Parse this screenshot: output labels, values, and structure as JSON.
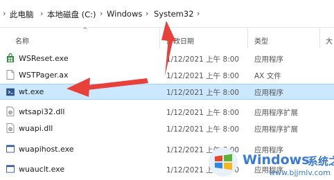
{
  "breadcrumb": {
    "items": [
      "此电脑",
      "本地磁盘 (C:)",
      "Windows",
      "System32"
    ]
  },
  "columns": {
    "name": "名称",
    "date": "修改日期",
    "type": "类型",
    "size": "大"
  },
  "files": [
    {
      "name": "WSReset.exe",
      "date": "1/12/2021 上午 8:00",
      "type": "应用程序",
      "icon": "wsreset-icon",
      "selected": false
    },
    {
      "name": "WSTPager.ax",
      "date": "1/12/2021 上午 8:00",
      "type": "AX 文件",
      "icon": "file-icon",
      "selected": false
    },
    {
      "name": "wt.exe",
      "date": "1/12/2021 上午 8:00",
      "type": "应用程序",
      "icon": "terminal-icon",
      "selected": true
    },
    {
      "name": "wtsapi32.dll",
      "date": "1/12/2021 上午 8:00",
      "type": "应用程序扩展",
      "icon": "dll-icon",
      "selected": false
    },
    {
      "name": "wuapi.dll",
      "date": "1/12/2021 上午 8:00",
      "type": "应用程序扩展",
      "icon": "dll-icon",
      "selected": false
    },
    {
      "name": "wuapihost.exe",
      "date": "1/12/2021 上午 8:00",
      "type": "应用程序",
      "icon": "exe-icon",
      "selected": false
    },
    {
      "name": "wuauclt.exe",
      "date": "1/12/2021 上午 8:00",
      "type": "应用程序",
      "icon": "exe-icon",
      "selected": false
    }
  ],
  "watermark": {
    "brand": "Windows",
    "cn": "系统之家",
    "url": "www.bjjmlv.com"
  },
  "colors": {
    "selection": "#cce8ff",
    "arrow": "#e8403a",
    "watermark": "#3a7ad8"
  }
}
